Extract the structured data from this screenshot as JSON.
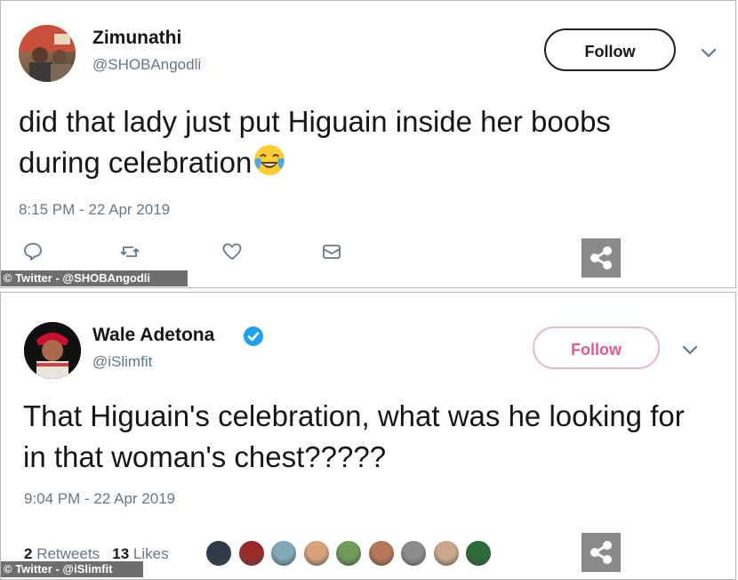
{
  "tweets": [
    {
      "display_name": "Zimunathi",
      "handle": "@SHOBAngodli",
      "follow_label": "Follow",
      "text": "did that lady just put Higuain inside her boobs during celebration",
      "emoji": "😂",
      "timestamp": "8:15 PM - 22 Apr 2019",
      "credit": "© Twitter - @SHOBAngodli"
    },
    {
      "display_name": "Wale Adetona",
      "verified": true,
      "handle": "@iSlimfit",
      "follow_label": "Follow",
      "text": "That Higuain's celebration, what was he looking for in that woman's chest?????",
      "timestamp": "9:04 PM - 22 Apr 2019",
      "retweets_count": "2",
      "retweets_label": "Retweets",
      "likes_count": "13",
      "likes_label": "Likes",
      "credit": "© Twitter - @iSlimfit"
    }
  ],
  "icons": {
    "reply": "reply-icon",
    "retweet": "retweet-icon",
    "like": "heart-icon",
    "dm": "envelope-icon",
    "share": "share-icon",
    "more": "chevron-down-icon",
    "verified": "verified-badge-icon"
  },
  "colors": {
    "text": "#14171a",
    "secondary": "#657786",
    "verified": "#1da1f2",
    "follow_pink": "#e0245e",
    "share_bg": "#8a8a8a"
  },
  "liker_avatars": [
    {
      "color": "#2f3b4a"
    },
    {
      "color": "#9b2b2b"
    },
    {
      "color": "#7fa9b5"
    },
    {
      "color": "#d8a27a"
    },
    {
      "color": "#6f9a5a"
    },
    {
      "color": "#b5785a"
    },
    {
      "color": "#8d8d8d"
    },
    {
      "color": "#c9a98a"
    },
    {
      "color": "#2c6b3a"
    }
  ]
}
